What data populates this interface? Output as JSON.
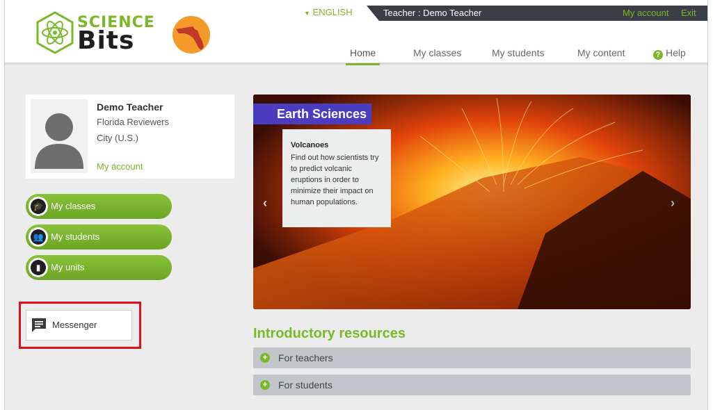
{
  "brand": {
    "line1": "SCIENCE",
    "line2": "Bits"
  },
  "topbar": {
    "language": "ENGLISH",
    "user": "Teacher : Demo Teacher",
    "my_account": "My account",
    "exit": "Exit"
  },
  "nav": {
    "home": "Home",
    "my_classes": "My classes",
    "my_students": "My students",
    "my_content": "My content",
    "help": "Help"
  },
  "profile": {
    "name": "Demo Teacher",
    "school": "Florida Reviewers",
    "city": "City (U.S.)",
    "account_link": "My account"
  },
  "side_buttons": {
    "classes": "My classes",
    "students": "My students",
    "units": "My units"
  },
  "messenger": {
    "label": "Messenger"
  },
  "hero": {
    "tag": "Earth Sciences",
    "card_title": "Volcanoes",
    "card_text": "Find out how scientists try to predict volcanic eruptions in order to minimize their impact on human populations."
  },
  "intro": {
    "title": "Introductory resources",
    "for_teachers": "For teachers",
    "for_students": "For students"
  },
  "colors": {
    "accent": "#7bb829",
    "banner_tag": "#4a3dbf",
    "highlight": "#e0101a",
    "topbar": "#3a3f47"
  }
}
